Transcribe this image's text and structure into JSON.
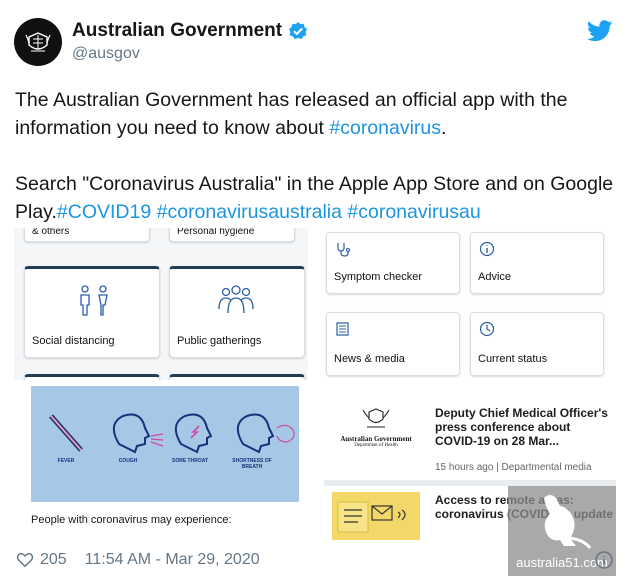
{
  "author": {
    "name": "Australian Government",
    "handle": "@ausgov"
  },
  "tweet": {
    "line1_text": "The Australian Government has released an official app with the information you need to know about ",
    "line1_tag": "#coronavirus",
    "line1_end": ".",
    "line2_text": "Search \"Coronavirus Australia\" in the Apple App Store and on Google Play.",
    "tags": [
      "#COVID19",
      "#coronavirusaustralia",
      "#coronavirusau"
    ]
  },
  "media": {
    "left_panel": {
      "cut_labels": [
        "& others",
        "Personal hygiene"
      ],
      "tiles": [
        "Social distancing",
        "Public gatherings"
      ]
    },
    "right_panel": {
      "tiles": [
        "Symptom checker",
        "Advice",
        "News & media",
        "Current status"
      ]
    },
    "symptoms": {
      "labels": [
        "FEVER",
        "COUGH",
        "SORE THROAT",
        "SHORTNESS OF BREATH"
      ],
      "caption": "People with coronavirus may experience:"
    },
    "news": {
      "logo_line1": "Australian Government",
      "logo_line2": "Department of Health",
      "title": "Deputy Chief Medical Officer's press conference about COVID-19 on 28 Mar...",
      "meta": "15 hours ago | Departmental media",
      "access_title": "Access to remote areas: coronavirus (COVID-19) update"
    }
  },
  "footer": {
    "likes": "205",
    "timestamp": "11:54 AM - Mar 29, 2020"
  },
  "watermark": "australia51.com",
  "colors": {
    "link": "#1b95e0",
    "verified": "#1da1f2",
    "muted": "#657786"
  }
}
